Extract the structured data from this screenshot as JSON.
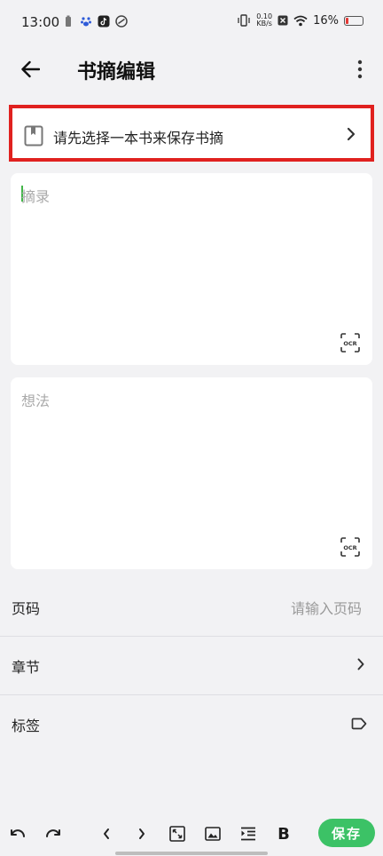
{
  "status_bar": {
    "time": "13:00",
    "net_speed_value": "0.10",
    "net_speed_unit": "KB/s",
    "battery_percent": "16%",
    "battery_level": 0.16,
    "battery_color": "#e53935"
  },
  "app_bar": {
    "title": "书摘编辑",
    "back_icon": "arrow-left-icon",
    "more_icon": "more-vertical-icon"
  },
  "book_select": {
    "label": "请先选择一本书来保存书摘",
    "icon": "book-icon",
    "chevron": "chevron-right-icon"
  },
  "excerpt": {
    "placeholder": "摘录",
    "ocr_label": "OCR"
  },
  "thoughts": {
    "placeholder": "想法",
    "ocr_label": "OCR"
  },
  "page_row": {
    "label": "页码",
    "placeholder": "请输入页码"
  },
  "chapter_row": {
    "label": "章节",
    "icon": "chevron-right-icon"
  },
  "tag_row": {
    "label": "标签",
    "icon": "tag-icon"
  },
  "toolbar": {
    "undo_icon": "undo-icon",
    "redo_icon": "redo-icon",
    "prev_icon": "chevron-left-icon",
    "next_icon": "chevron-right-icon",
    "expand_icon": "expand-icon",
    "image_icon": "image-icon",
    "indent_icon": "indent-icon",
    "bold_label": "B",
    "save_label": "保存"
  },
  "colors": {
    "accent": "#3cc266",
    "highlight_border": "#e0211f",
    "background": "#f2f2f4"
  }
}
